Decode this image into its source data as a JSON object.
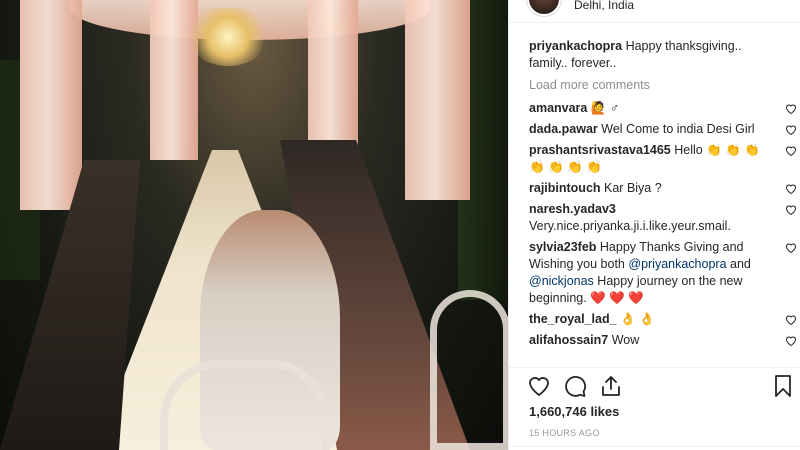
{
  "post": {
    "location": "Delhi, India",
    "photo_label": "dinner-party-photo"
  },
  "caption": {
    "username": "priyankachopra",
    "text": "Happy thanksgiving.. family.. forever.."
  },
  "load_more": "Load more comments",
  "comments": [
    {
      "username": "amanvara",
      "text": "🙋 ♂"
    },
    {
      "username": "dada.pawar",
      "text": "Wel Come to india Desi Girl"
    },
    {
      "username": "prashantsrivastava1465",
      "text": "Hello 👏 👏 👏 👏 👏 👏 👏"
    },
    {
      "username": "rajibintouch",
      "text": "Kar Biya ?"
    },
    {
      "username": "naresh.yadav3",
      "text": "Very.nice.priyanka.ji.i.like.yeur.smail."
    },
    {
      "username": "sylvia23feb",
      "text_a": "Happy Thanks Giving and Wishing you both",
      "mention_1": "@priyankachopra",
      "text_b": "and",
      "mention_2": "@nickjonas",
      "text_c": "Happy journey on the new beginning. ❤️ ❤️ ❤️"
    },
    {
      "username": "the_royal_lad_",
      "text": "👌 👌"
    },
    {
      "username": "alifahossain7",
      "text": "Wow"
    }
  ],
  "actions": {
    "like_icon": "heart-icon",
    "comment_icon": "comment-icon",
    "share_icon": "share-icon",
    "save_icon": "bookmark-icon"
  },
  "likes": "1,660,746 likes",
  "timestamp": "15 HOURS AGO",
  "colors": {
    "text": "#262626",
    "muted": "#8e8e8e",
    "mention": "#003569",
    "timestamp": "#999999",
    "border": "#efefef"
  }
}
